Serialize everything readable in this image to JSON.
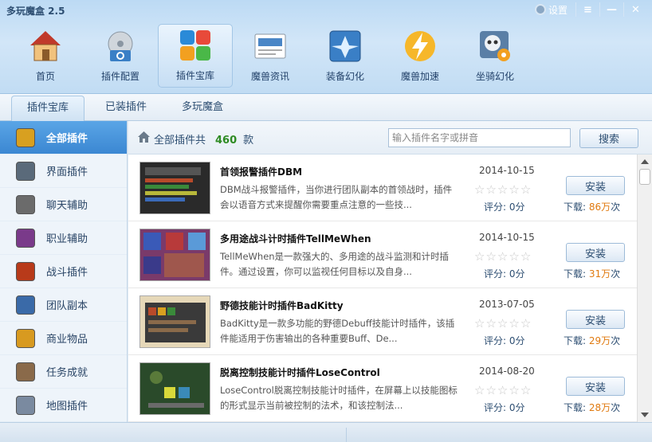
{
  "app": {
    "title": "多玩魔盒 2.5",
    "settings_label": "设置"
  },
  "window_controls": {
    "menu": "≡",
    "minimize": "—",
    "close": "✕"
  },
  "nav": [
    {
      "label": "首页",
      "icon": "home-icon"
    },
    {
      "label": "插件配置",
      "icon": "disc-settings-icon"
    },
    {
      "label": "插件宝库",
      "icon": "plugin-store-icon",
      "active": true
    },
    {
      "label": "魔兽资讯",
      "icon": "news-icon"
    },
    {
      "label": "装备幻化",
      "icon": "transmog-icon"
    },
    {
      "label": "魔兽加速",
      "icon": "lightning-icon"
    },
    {
      "label": "坐骑幻化",
      "icon": "skull-gear-icon"
    }
  ],
  "tabs": [
    {
      "label": "插件宝库",
      "active": true
    },
    {
      "label": "已装插件"
    },
    {
      "label": "多玩魔盒"
    }
  ],
  "sidebar": [
    {
      "label": "全部插件",
      "active": true,
      "icon": "all-plugins-icon",
      "color": "#d8a020"
    },
    {
      "label": "界面插件",
      "icon": "interface-icon",
      "color": "#5a6a7a"
    },
    {
      "label": "聊天辅助",
      "icon": "chat-icon",
      "color": "#6b6b6b"
    },
    {
      "label": "职业辅助",
      "icon": "class-icon",
      "color": "#7a3a8a"
    },
    {
      "label": "战斗插件",
      "icon": "combat-icon",
      "color": "#b83a1a"
    },
    {
      "label": "团队副本",
      "icon": "raid-icon",
      "color": "#3a6aa8"
    },
    {
      "label": "商业物品",
      "icon": "trade-icon",
      "color": "#d89a20"
    },
    {
      "label": "任务成就",
      "icon": "quest-icon",
      "color": "#8a6a4a"
    },
    {
      "label": "地图插件",
      "icon": "map-icon",
      "color": "#7a8aa0"
    }
  ],
  "toolbar": {
    "count_prefix": "全部插件共",
    "count": "460",
    "count_suffix": "款",
    "search_placeholder": "输入插件名字或拼音",
    "search_button": "搜索"
  },
  "plugins": [
    {
      "name": "首领报警插件DBM",
      "desc": "DBM战斗报警插件，当你进行团队副本的首领战时，插件会以语音方式来提醒你需要重点注意的一些技...",
      "date": "2014-10-15",
      "rating_text": "评分: 0分",
      "install": "安装",
      "dl_prefix": "下载:",
      "dl_num": "86万",
      "dl_suffix": "次",
      "thumb_color": "#2a2a2a"
    },
    {
      "name": "多用途战斗计时插件TellMeWhen",
      "desc": "TellMeWhen是一款强大的、多用途的战斗监测和计时插件。通过设置，你可以监视任何目标以及自身...",
      "date": "2014-10-15",
      "rating_text": "评分: 0分",
      "install": "安装",
      "dl_prefix": "下载:",
      "dl_num": "31万",
      "dl_suffix": "次",
      "thumb_color": "#7a3a6a"
    },
    {
      "name": "野德技能计时插件BadKitty",
      "desc": "BadKitty是一款多功能的野德Debuff技能计时插件，该插件能适用于伤害输出的各种重要Buff、De...",
      "date": "2013-07-05",
      "rating_text": "评分: 0分",
      "install": "安装",
      "dl_prefix": "下载:",
      "dl_num": "29万",
      "dl_suffix": "次",
      "thumb_color": "#e6d8b8"
    },
    {
      "name": "脱离控制技能计时插件LoseControl",
      "desc": "LoseControl脱离控制技能计时插件，在屏幕上以技能图标的形式显示当前被控制的法术，和该控制法...",
      "date": "2014-08-20",
      "rating_text": "评分: 0分",
      "install": "安装",
      "dl_prefix": "下载:",
      "dl_num": "28万",
      "dl_suffix": "次",
      "thumb_color": "#3a5a3a"
    }
  ],
  "rating_stars": 0,
  "colors": {
    "accent": "#3b87d2",
    "count": "#2e8b23",
    "downloads": "#e07a10"
  }
}
